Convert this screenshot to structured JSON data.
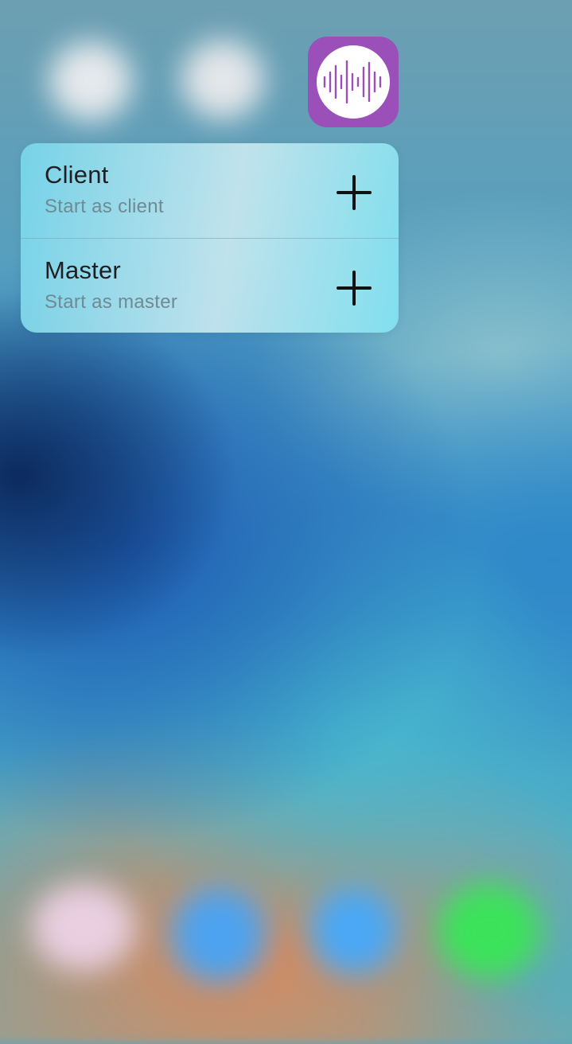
{
  "app": {
    "icon_name": "sound-wave-icon",
    "icon_bg_color": "#9b4fb8",
    "icon_fg_color": "#9b4fb8"
  },
  "quick_actions": [
    {
      "title": "Client",
      "subtitle": "Start as client",
      "icon": "plus-icon"
    },
    {
      "title": "Master",
      "subtitle": "Start as master",
      "icon": "plus-icon"
    }
  ]
}
